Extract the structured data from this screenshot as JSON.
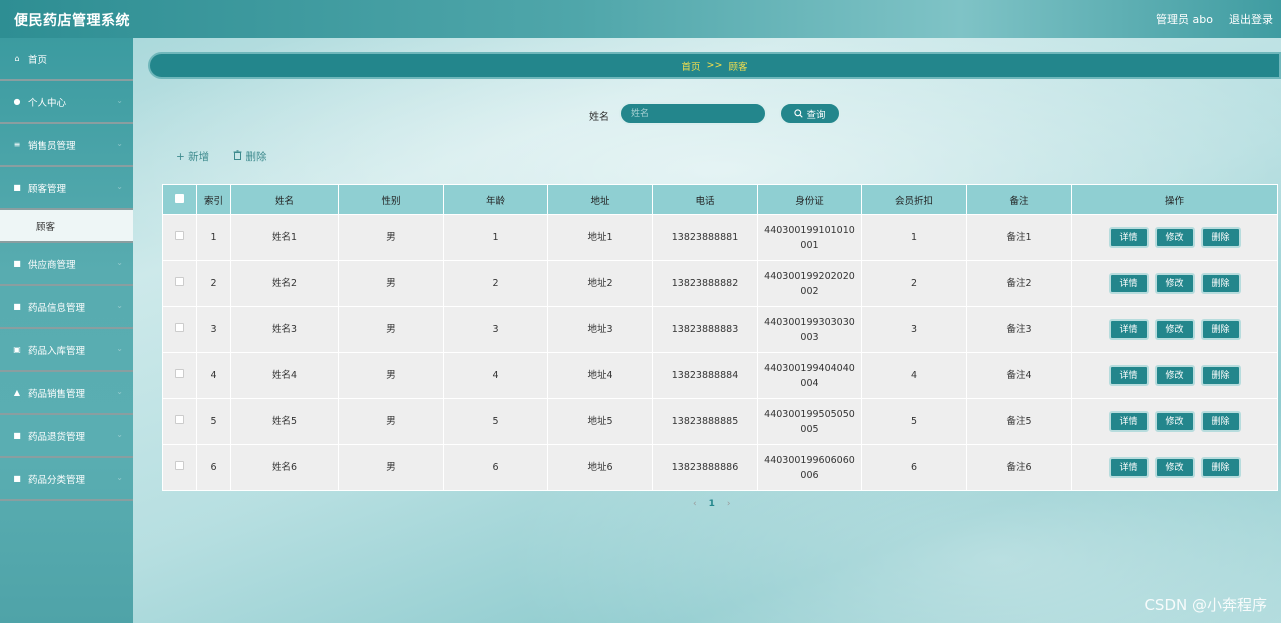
{
  "header": {
    "title": "便民药店管理系统",
    "user": "管理员 abo",
    "logout": "退出登录"
  },
  "sidebar": {
    "items": [
      {
        "icon": "home-icon",
        "glyph": "⌂",
        "label": "首页"
      },
      {
        "icon": "user-icon",
        "glyph": "●",
        "label": "个人中心"
      },
      {
        "icon": "list-icon",
        "glyph": "≡",
        "label": "销售员管理"
      },
      {
        "icon": "grid-icon",
        "glyph": "■",
        "label": "顾客管理"
      },
      {
        "sub": true,
        "label": "顾客"
      },
      {
        "icon": "grid-icon",
        "glyph": "■",
        "label": "供应商管理"
      },
      {
        "icon": "grid-icon",
        "glyph": "■",
        "label": "药品信息管理"
      },
      {
        "icon": "clipboard-icon",
        "glyph": "▣",
        "label": "药品入库管理"
      },
      {
        "icon": "bag-icon",
        "glyph": "▲",
        "label": "药品销售管理"
      },
      {
        "icon": "grid-icon",
        "glyph": "■",
        "label": "药品退货管理"
      },
      {
        "icon": "grid-icon",
        "glyph": "■",
        "label": "药品分类管理"
      }
    ]
  },
  "breadcrumb": {
    "home": "首页",
    "sep": ">>",
    "current": "顾客"
  },
  "search": {
    "label": "姓名",
    "placeholder": "姓名",
    "button": "查询"
  },
  "toolbar": {
    "add": "+ 新增",
    "delete": "删除"
  },
  "table": {
    "headers": [
      "索引",
      "姓名",
      "性别",
      "年龄",
      "地址",
      "电话",
      "身份证",
      "会员折扣",
      "备注",
      "操作"
    ],
    "rows": [
      [
        "1",
        "姓名1",
        "男",
        "1",
        "地址1",
        "13823888881",
        "440300199101010001",
        "1",
        "备注1"
      ],
      [
        "2",
        "姓名2",
        "男",
        "2",
        "地址2",
        "13823888882",
        "440300199202020002",
        "2",
        "备注2"
      ],
      [
        "3",
        "姓名3",
        "男",
        "3",
        "地址3",
        "13823888883",
        "440300199303030003",
        "3",
        "备注3"
      ],
      [
        "4",
        "姓名4",
        "男",
        "4",
        "地址4",
        "13823888884",
        "440300199404040004",
        "4",
        "备注4"
      ],
      [
        "5",
        "姓名5",
        "男",
        "5",
        "地址5",
        "13823888885",
        "440300199505050005",
        "5",
        "备注5"
      ],
      [
        "6",
        "姓名6",
        "男",
        "6",
        "地址6",
        "13823888886",
        "440300199606060006",
        "6",
        "备注6"
      ]
    ],
    "actions": [
      "详情",
      "修改",
      "删除"
    ]
  },
  "pager": {
    "prev": "‹",
    "page": "1",
    "next": "›"
  },
  "watermark": "CSDN @小奔程序"
}
